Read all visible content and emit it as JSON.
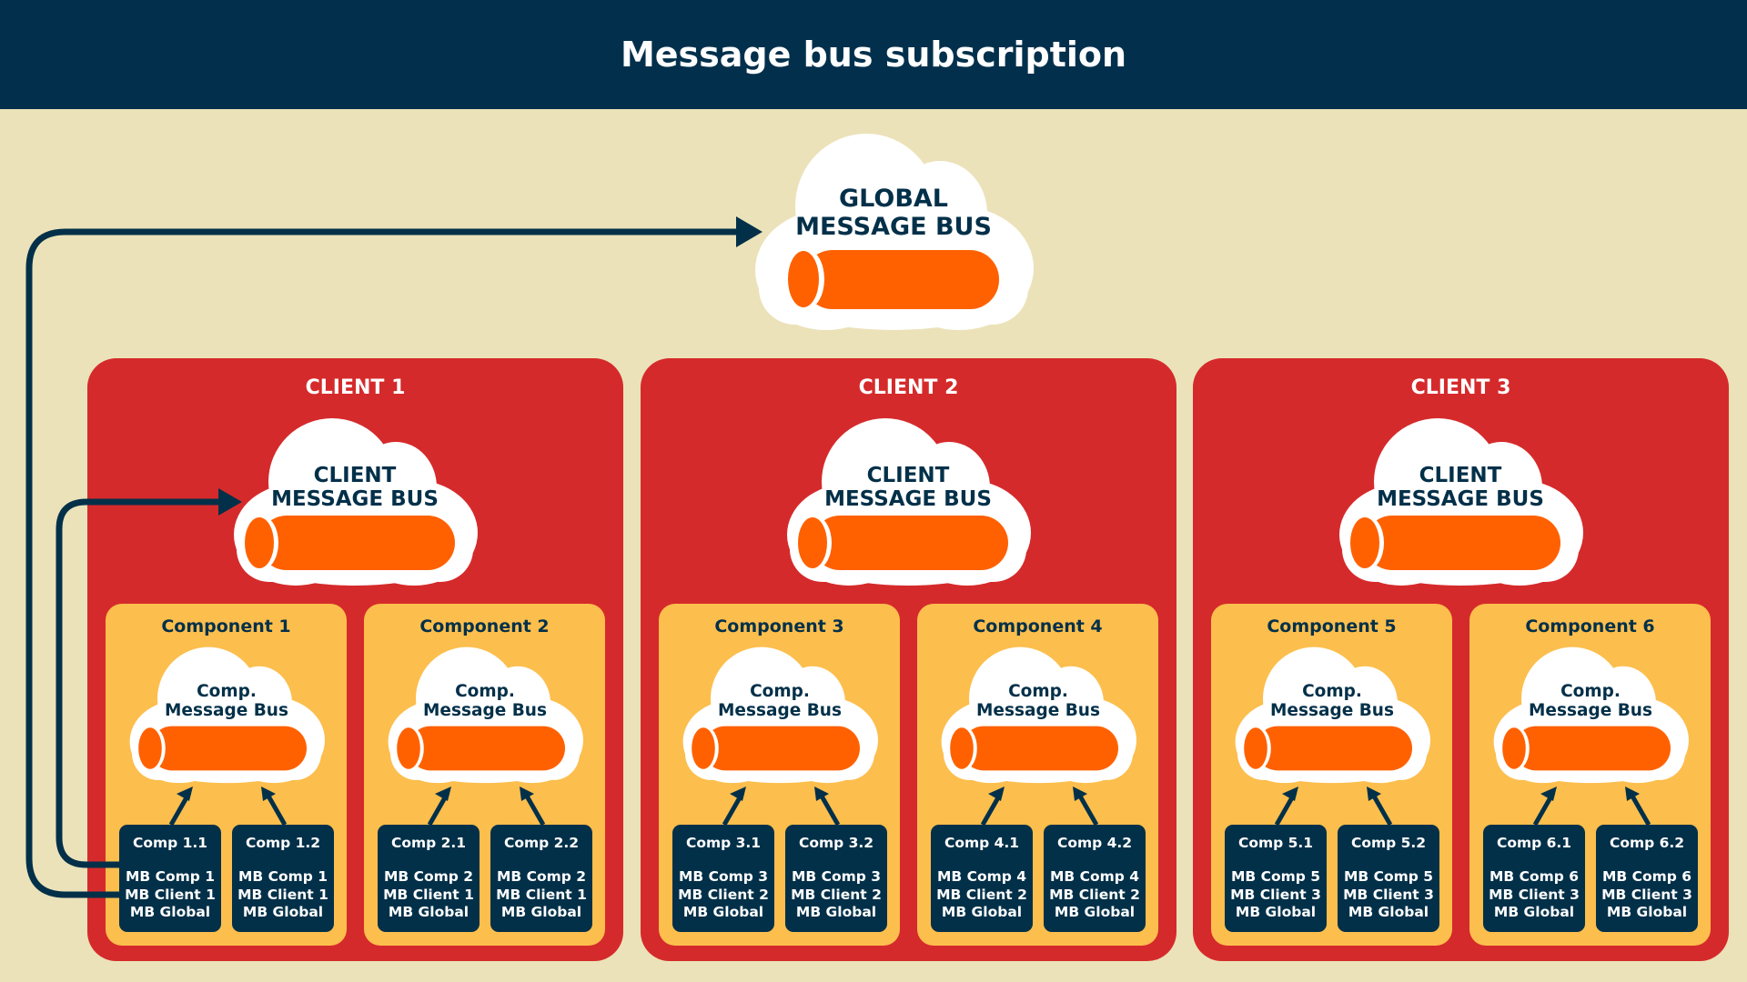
{
  "header": {
    "title": "Message bus subscription"
  },
  "colors": {
    "header_bg": "#02304c",
    "background": "#ebe2b9",
    "client_bg": "#d52a2b",
    "component_bg": "#fcbe4d",
    "comp_box_bg": "#033049",
    "pipe": "#ff6100",
    "cloud": "#ffffff",
    "text_dark": "#033049"
  },
  "global_bus": {
    "label_line1": "GLOBAL",
    "label_line2": "MESSAGE BUS"
  },
  "clients": [
    {
      "title": "CLIENT 1",
      "bus": {
        "label_line1": "CLIENT",
        "label_line2": "MESSAGE BUS"
      },
      "components": [
        {
          "title": "Component 1",
          "bus_line1": "Comp.",
          "bus_line2": "Message Bus",
          "comps": [
            {
              "name": "Comp 1.1",
              "subs": [
                "MB Comp 1",
                "MB Client 1",
                "MB Global"
              ]
            },
            {
              "name": "Comp 1.2",
              "subs": [
                "MB Comp 1",
                "MB Client 1",
                "MB Global"
              ]
            }
          ]
        },
        {
          "title": "Component 2",
          "bus_line1": "Comp.",
          "bus_line2": "Message Bus",
          "comps": [
            {
              "name": "Comp 2.1",
              "subs": [
                "MB Comp 2",
                "MB Client 1",
                "MB Global"
              ]
            },
            {
              "name": "Comp 2.2",
              "subs": [
                "MB Comp 2",
                "MB Client 1",
                "MB Global"
              ]
            }
          ]
        }
      ]
    },
    {
      "title": "CLIENT 2",
      "bus": {
        "label_line1": "CLIENT",
        "label_line2": "MESSAGE BUS"
      },
      "components": [
        {
          "title": "Component 3",
          "bus_line1": "Comp.",
          "bus_line2": "Message Bus",
          "comps": [
            {
              "name": "Comp 3.1",
              "subs": [
                "MB Comp 3",
                "MB Client 2",
                "MB Global"
              ]
            },
            {
              "name": "Comp 3.2",
              "subs": [
                "MB Comp 3",
                "MB Client 2",
                "MB Global"
              ]
            }
          ]
        },
        {
          "title": "Component 4",
          "bus_line1": "Comp.",
          "bus_line2": "Message Bus",
          "comps": [
            {
              "name": "Comp 4.1",
              "subs": [
                "MB Comp 4",
                "MB Client 2",
                "MB Global"
              ]
            },
            {
              "name": "Comp 4.2",
              "subs": [
                "MB Comp 4",
                "MB Client 2",
                "MB Global"
              ]
            }
          ]
        }
      ]
    },
    {
      "title": "CLIENT 3",
      "bus": {
        "label_line1": "CLIENT",
        "label_line2": "MESSAGE BUS"
      },
      "components": [
        {
          "title": "Component 5",
          "bus_line1": "Comp.",
          "bus_line2": "Message Bus",
          "comps": [
            {
              "name": "Comp 5.1",
              "subs": [
                "MB Comp 5",
                "MB Client 3",
                "MB Global"
              ]
            },
            {
              "name": "Comp 5.2",
              "subs": [
                "MB Comp 5",
                "MB Client 3",
                "MB Global"
              ]
            }
          ]
        },
        {
          "title": "Component 6",
          "bus_line1": "Comp.",
          "bus_line2": "Message Bus",
          "comps": [
            {
              "name": "Comp 6.1",
              "subs": [
                "MB Comp 6",
                "MB Client 3",
                "MB Global"
              ]
            },
            {
              "name": "Comp 6.2",
              "subs": [
                "MB Comp 6",
                "MB Client 3",
                "MB Global"
              ]
            }
          ]
        }
      ]
    }
  ]
}
